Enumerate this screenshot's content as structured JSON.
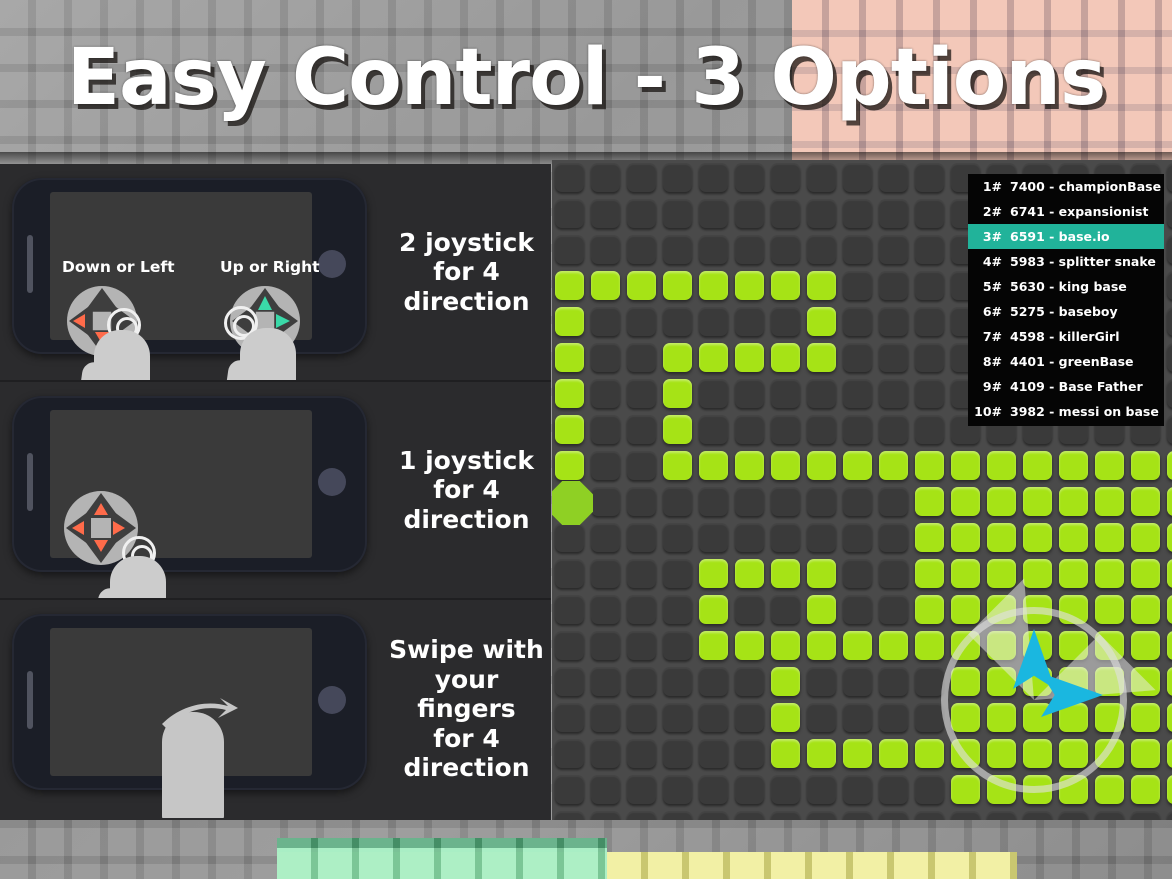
{
  "title": "Easy Control - 3 Options",
  "control_panels": [
    {
      "caption": "2 joystick\nfor 4\ndirection",
      "caption_lines": [
        "2 joystick",
        "for 4",
        "direction"
      ],
      "left_label": "Down or Left",
      "right_label": "Up or Right",
      "joysticks": 2,
      "mode": "dual-joystick"
    },
    {
      "caption_lines": [
        "1 joystick",
        "for 4",
        "direction"
      ],
      "joysticks": 1,
      "mode": "single-joystick"
    },
    {
      "caption_lines": [
        "Swipe with",
        "your fingers",
        "for 4",
        "direction"
      ],
      "joysticks": 0,
      "mode": "swipe"
    }
  ],
  "leaderboard": {
    "rows": [
      {
        "rank": "1#",
        "score": "7400",
        "name": "championBase",
        "highlight": false
      },
      {
        "rank": "2#",
        "score": "6741",
        "name": "expansionist",
        "highlight": false
      },
      {
        "rank": "3#",
        "score": "6591",
        "name": "base.io",
        "highlight": true
      },
      {
        "rank": "4#",
        "score": "5983",
        "name": "splitter snake",
        "highlight": false
      },
      {
        "rank": "5#",
        "score": "5630",
        "name": "king base",
        "highlight": false
      },
      {
        "rank": "6#",
        "score": "5275",
        "name": "baseboy",
        "highlight": false
      },
      {
        "rank": "7#",
        "score": "4598",
        "name": "killerGirl",
        "highlight": false
      },
      {
        "rank": "8#",
        "score": "4401",
        "name": "greenBase",
        "highlight": false
      },
      {
        "rank": "9#",
        "score": "4109",
        "name": "Base Father",
        "highlight": false
      },
      {
        "rank": "10#",
        "score": "3982",
        "name": "messi on base",
        "highlight": false
      }
    ]
  },
  "board": {
    "cols": 18,
    "rows": 19,
    "cell_size": 36,
    "trail_cells": [
      [
        0,
        3
      ],
      [
        1,
        3
      ],
      [
        2,
        3
      ],
      [
        3,
        3
      ],
      [
        4,
        3
      ],
      [
        5,
        3
      ],
      [
        6,
        3
      ],
      [
        7,
        3
      ],
      [
        0,
        4
      ],
      [
        7,
        4
      ],
      [
        0,
        5
      ],
      [
        3,
        5
      ],
      [
        4,
        5
      ],
      [
        5,
        5
      ],
      [
        6,
        5
      ],
      [
        7,
        5
      ],
      [
        0,
        6
      ],
      [
        3,
        6
      ],
      [
        0,
        7
      ],
      [
        3,
        7
      ],
      [
        0,
        8
      ],
      [
        3,
        8
      ],
      [
        4,
        8
      ],
      [
        5,
        8
      ],
      [
        6,
        8
      ],
      [
        7,
        8
      ],
      [
        8,
        8
      ],
      [
        9,
        8
      ],
      [
        10,
        8
      ],
      [
        10,
        9
      ],
      [
        10,
        10
      ],
      [
        4,
        11
      ],
      [
        5,
        11
      ],
      [
        6,
        11
      ],
      [
        7,
        11
      ],
      [
        10,
        11
      ],
      [
        4,
        12
      ],
      [
        7,
        12
      ],
      [
        10,
        12
      ],
      [
        4,
        13
      ],
      [
        5,
        13
      ],
      [
        6,
        13
      ],
      [
        7,
        13
      ],
      [
        8,
        13
      ],
      [
        9,
        13
      ],
      [
        10,
        13
      ],
      [
        6,
        14
      ],
      [
        6,
        15
      ],
      [
        6,
        16
      ],
      [
        7,
        16
      ],
      [
        8,
        16
      ],
      [
        9,
        16
      ],
      [
        10,
        16
      ],
      [
        11,
        16
      ]
    ],
    "snake_head": {
      "col": 0,
      "row": 9
    },
    "territory": {
      "col_start": 11,
      "row_start": 8,
      "col_end": 17,
      "row_end": 17
    }
  },
  "joystick_overlay": {
    "up_arrow": "arrow-up-icon",
    "right_arrow": "arrow-right-icon"
  },
  "colors": {
    "accent_green": "#a6e316",
    "board_bg": "#4a4a4a",
    "cell_off": "#3a3a3a",
    "leaderboard_bg": "#050505",
    "leaderboard_highlight": "#21b39a",
    "panel_bg": "#2b2b2d",
    "arrow_cyan": "#1ab7e0",
    "arrow_red": "#ff6b4a",
    "arrow_mint": "#3ad9a8",
    "salmon": "#edab94",
    "title_text": "#ffffff"
  }
}
